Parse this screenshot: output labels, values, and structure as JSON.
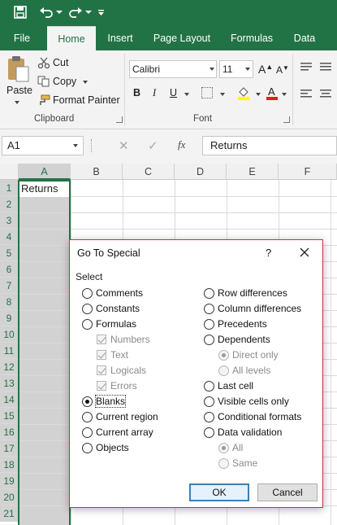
{
  "qat": {
    "save_icon": "save-icon",
    "undo_icon": "undo-icon",
    "redo_icon": "redo-icon",
    "customize_icon": "customize-qat-icon"
  },
  "tabs": [
    {
      "label": "File"
    },
    {
      "label": "Home",
      "active": true
    },
    {
      "label": "Insert"
    },
    {
      "label": "Page Layout"
    },
    {
      "label": "Formulas"
    },
    {
      "label": "Data"
    }
  ],
  "ribbon": {
    "clipboard": {
      "paste": "Paste",
      "cut": "Cut",
      "copy": "Copy",
      "format_painter": "Format Painter",
      "group_label": "Clipboard"
    },
    "font": {
      "font_name": "Calibri",
      "font_size": "11",
      "bold": "B",
      "italic": "I",
      "underline": "U",
      "group_label": "Font"
    }
  },
  "formula_bar": {
    "name_box": "A1",
    "fx": "fx",
    "content": "Returns"
  },
  "grid": {
    "columns": [
      "A",
      "B",
      "C",
      "D",
      "E",
      "F"
    ],
    "rows": [
      "1",
      "2",
      "3",
      "4",
      "5",
      "6",
      "7",
      "8",
      "9",
      "10",
      "11",
      "12",
      "13",
      "14",
      "15",
      "16",
      "17",
      "18",
      "19",
      "20",
      "21"
    ],
    "a1_value": "Returns"
  },
  "dialog": {
    "title": "Go To Special",
    "help": "?",
    "section_label": "Select",
    "left_options": {
      "comments": "Comments",
      "constants": "Constants",
      "formulas": "Formulas",
      "numbers": "Numbers",
      "text": "Text",
      "logicals": "Logicals",
      "errors": "Errors",
      "blanks": "Blanks",
      "current_region": "Current region",
      "current_array": "Current array",
      "objects": "Objects"
    },
    "right_options": {
      "row_differences": "Row differences",
      "column_differences": "Column differences",
      "precedents": "Precedents",
      "dependents": "Dependents",
      "direct_only": "Direct only",
      "all_levels": "All levels",
      "last_cell": "Last cell",
      "visible_cells_only": "Visible cells only",
      "conditional_formats": "Conditional formats",
      "data_validation": "Data validation",
      "all": "All",
      "same": "Same"
    },
    "selected_option": "Blanks",
    "ok_label": "OK",
    "cancel_label": "Cancel"
  },
  "colors": {
    "excel_green": "#217346",
    "dialog_border": "#c7343d",
    "selection_gray": "#d2d2d2"
  }
}
